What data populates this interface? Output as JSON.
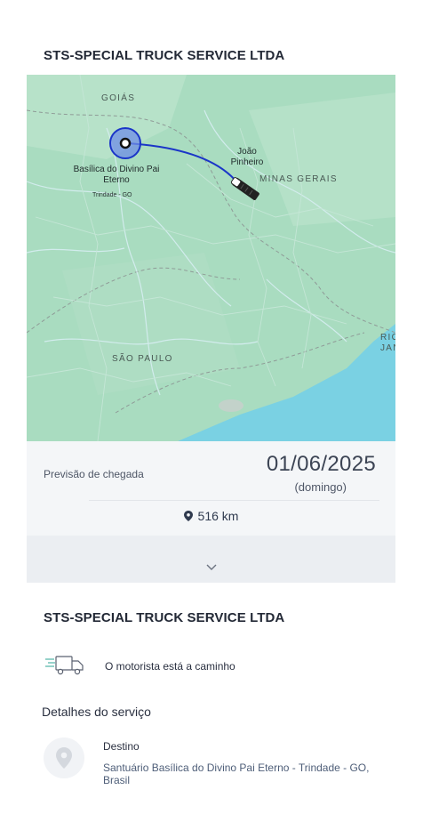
{
  "company_title": "STS-SPECIAL TRUCK SERVICE LTDA",
  "map": {
    "labels": {
      "state_goias": "GOIÁS",
      "state_minas": "MINAS GERAIS",
      "state_sao_paulo": "SÃO PAULO",
      "state_rio_partial": "RIO JAN",
      "city_joao_pinheiro": "João Pinheiro",
      "origin_name": "Basílica do Divino Pai Eterno",
      "origin_sub": "Trindade - GO"
    },
    "route_color": "#1a35c8",
    "water_color": "#7ad1e3",
    "land_color": "#a9dcc0"
  },
  "eta": {
    "label": "Previsão de chegada",
    "date": "01/06/2025",
    "weekday": "(domingo)"
  },
  "distance": {
    "icon": "location-pin-icon",
    "value": "516 km"
  },
  "expand": {
    "icon": "chevron-down-icon"
  },
  "carrier_title": "STS-SPECIAL TRUCK SERVICE LTDA",
  "status": {
    "icon": "moving-truck-icon",
    "text": "O motorista está a caminho"
  },
  "details": {
    "section_title": "Detalhes do serviço",
    "destination_label": "Destino",
    "destination_address": "Santuário Basílica do Divino Pai Eterno -  Trindade - GO, Brasil",
    "destination_icon": "location-pin-icon"
  }
}
